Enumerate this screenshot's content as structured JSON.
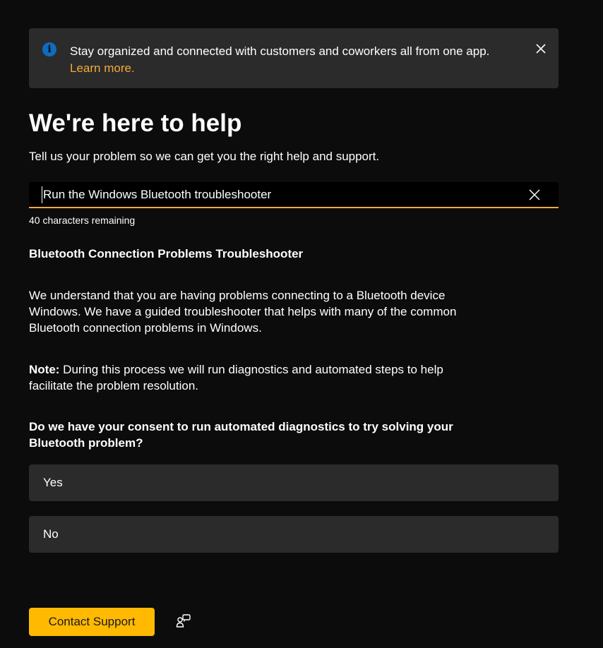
{
  "banner": {
    "icon": "info-icon",
    "icon_glyph": "i",
    "message": "Stay organized and connected with customers and coworkers all from one app.",
    "link": "Learn more.",
    "close_icon": "close-icon",
    "link_color": "#f2a93b",
    "icon_color": "#0f6cbd"
  },
  "header": {
    "title": "We're here to help",
    "subtitle": "Tell us your problem so we can get you the right help and support."
  },
  "search": {
    "value": "Run the Windows Bluetooth troubleshooter",
    "clear_icon": "close-icon",
    "chars_remaining": "40 characters remaining",
    "focus_color": "#f2a93b"
  },
  "article": {
    "title": "Bluetooth Connection Problems Troubleshooter",
    "paragraph_1": "We understand that you are having problems connecting to a Bluetooth device Windows. We have a guided troubleshooter that helps with many of the common Bluetooth connection problems in Windows.",
    "note_label": "Note:",
    "note_text": " During this process we will run diagnostics and automated steps to help facilitate the problem resolution.",
    "consent_question": "Do we have your consent to run automated diagnostics to try solving your Bluetooth problem?"
  },
  "options": [
    {
      "label": "Yes"
    },
    {
      "label": "No"
    }
  ],
  "footer": {
    "contact_label": "Contact Support",
    "contact_color": "#ffb900",
    "share_icon": "share-feedback-icon"
  }
}
